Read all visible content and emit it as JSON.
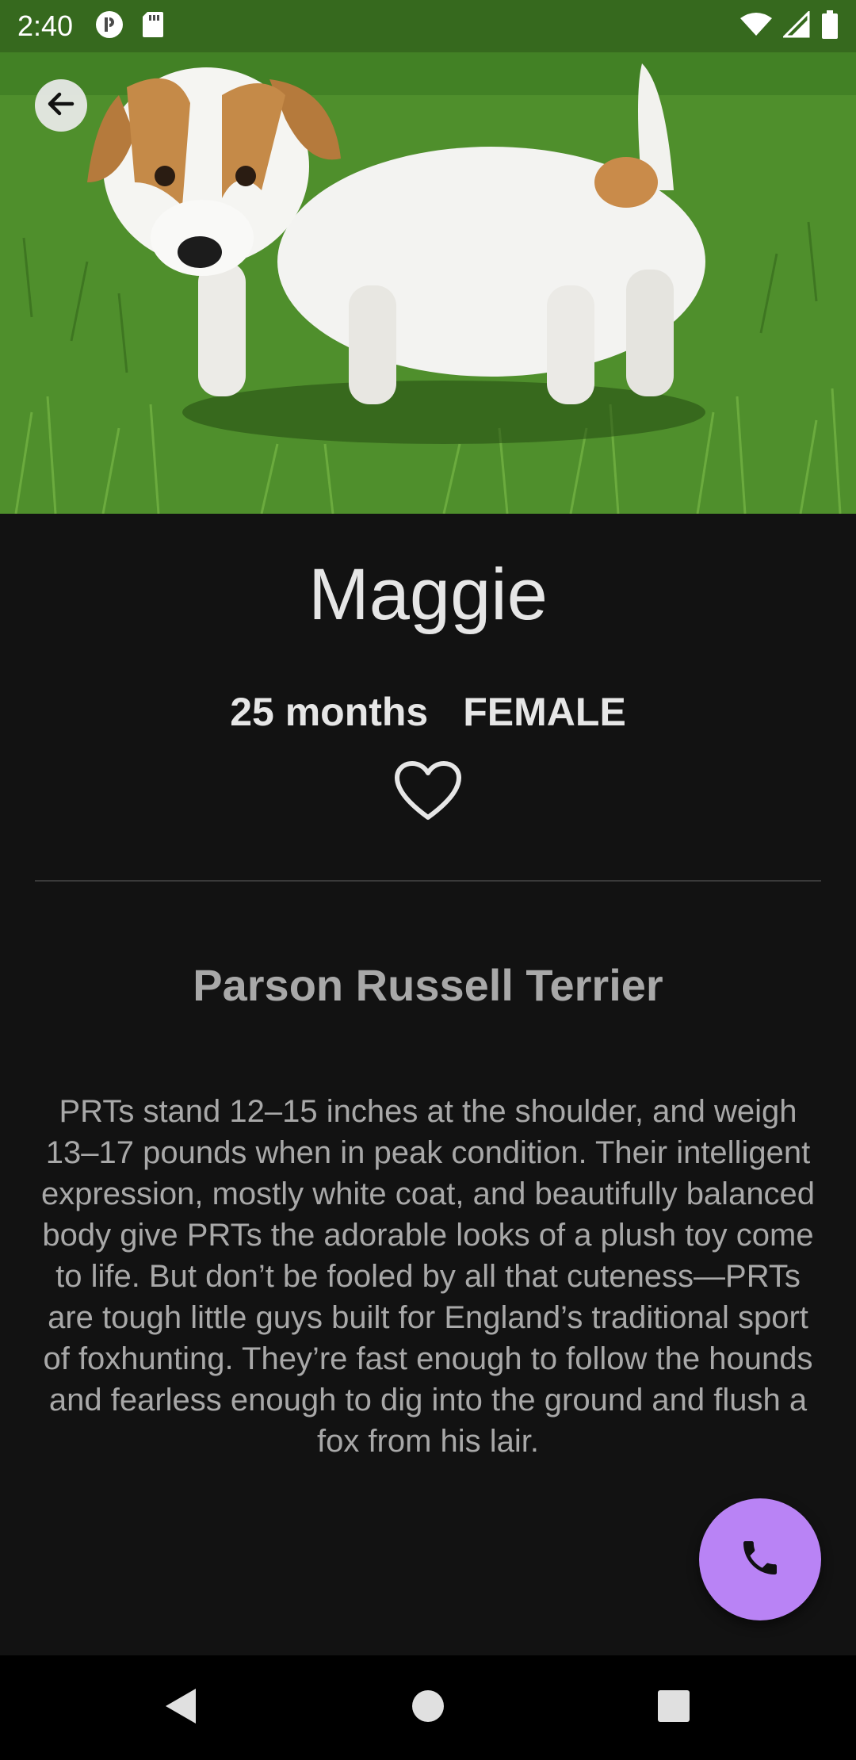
{
  "status_bar": {
    "time": "2:40",
    "icons": [
      "app-notification-icon",
      "sd-card-icon",
      "wifi-icon",
      "cell-signal-icon",
      "battery-icon"
    ]
  },
  "hero": {
    "icon": "back-arrow-icon"
  },
  "pet": {
    "name": "Maggie",
    "age": "25 months",
    "gender": "FEMALE",
    "favorite_icon": "heart-outline-icon",
    "breed": "Parson Russell Terrier",
    "description": "PRTs stand 12–15 inches at the shoulder, and weigh 13–17 pounds when in peak condition. Their intelligent expression, mostly white coat, and beautifully balanced body give PRTs the adorable looks of a plush toy come to life. But don’t be fooled by all that cuteness—PRTs are tough little guys built for England’s traditional sport of foxhunting. They’re fast enough to follow the hounds and fearless enough to dig into the ground and flush a fox from his lair."
  },
  "fab": {
    "icon": "phone-icon",
    "color": "#b983f5"
  },
  "nav": {
    "icons": [
      "nav-back-icon",
      "nav-home-icon",
      "nav-recents-icon"
    ]
  },
  "colors": {
    "background": "#121212",
    "primary_text": "#e6e6e6",
    "secondary_text": "#a8a8a8",
    "accent": "#b983f5"
  }
}
